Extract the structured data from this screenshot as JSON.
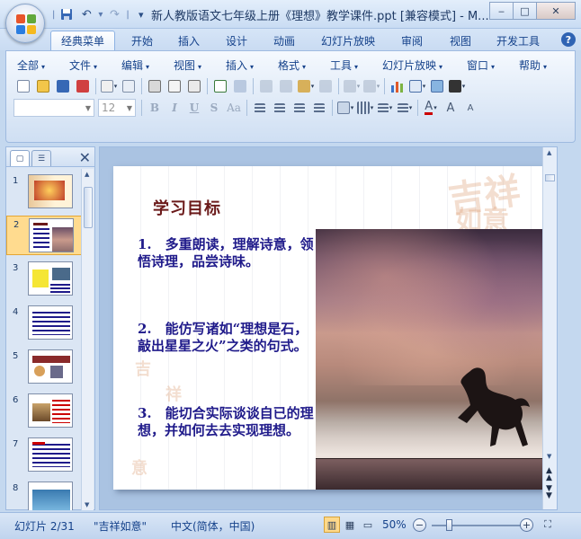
{
  "window": {
    "title": "新人教版语文七年级上册《理想》教学课件.ppt [兼容模式] - M...",
    "controls": {
      "minimize": "‒",
      "maximize": "□",
      "close": "✕"
    }
  },
  "qat": {
    "save_icon": "save-icon",
    "undo": "↶",
    "redo": "↷",
    "customize": "▾"
  },
  "tabs": [
    {
      "label": "经典菜单",
      "active": true
    },
    {
      "label": "开始"
    },
    {
      "label": "插入"
    },
    {
      "label": "设计"
    },
    {
      "label": "动画"
    },
    {
      "label": "幻灯片放映"
    },
    {
      "label": "审阅"
    },
    {
      "label": "视图"
    },
    {
      "label": "开发工具"
    }
  ],
  "help": "?",
  "menus": [
    {
      "label": "全部"
    },
    {
      "label": "文件"
    },
    {
      "label": "编辑"
    },
    {
      "label": "视图"
    },
    {
      "label": "插入"
    },
    {
      "label": "格式"
    },
    {
      "label": "工具"
    },
    {
      "label": "幻灯片放映"
    },
    {
      "label": "窗口"
    },
    {
      "label": "帮助"
    }
  ],
  "font": {
    "size_placeholder": "12",
    "bold": "B",
    "italic": "I",
    "underline": "U",
    "shadow": "S",
    "case": "Aa"
  },
  "pane": {
    "slides_tab": "▢",
    "outline_tab": "☰",
    "close": "✕"
  },
  "thumbnails": [
    {
      "num": "1"
    },
    {
      "num": "2",
      "selected": true
    },
    {
      "num": "3"
    },
    {
      "num": "4"
    },
    {
      "num": "5"
    },
    {
      "num": "6"
    },
    {
      "num": "7"
    },
    {
      "num": "8"
    }
  ],
  "slide": {
    "title": "学习目标",
    "objectives": [
      "1.　多重朗读，理解诗意，领悟诗理，品尝诗味。",
      "2.　能仿写诸如“理想是石，敲出星星之火”之类的句式。",
      "3.　能切合实际谈谈自已的理想，并如何去去实现理想。"
    ]
  },
  "status": {
    "slide_info": "幻灯片 2/31",
    "theme": "\"吉祥如意\"",
    "language": "中文(简体，中国)",
    "zoom": "50%"
  },
  "colors": {
    "accent": "#15428b",
    "title_red": "#6b1a1a",
    "text_blue": "#1f1a8a",
    "selected": "#ffdb8f"
  }
}
